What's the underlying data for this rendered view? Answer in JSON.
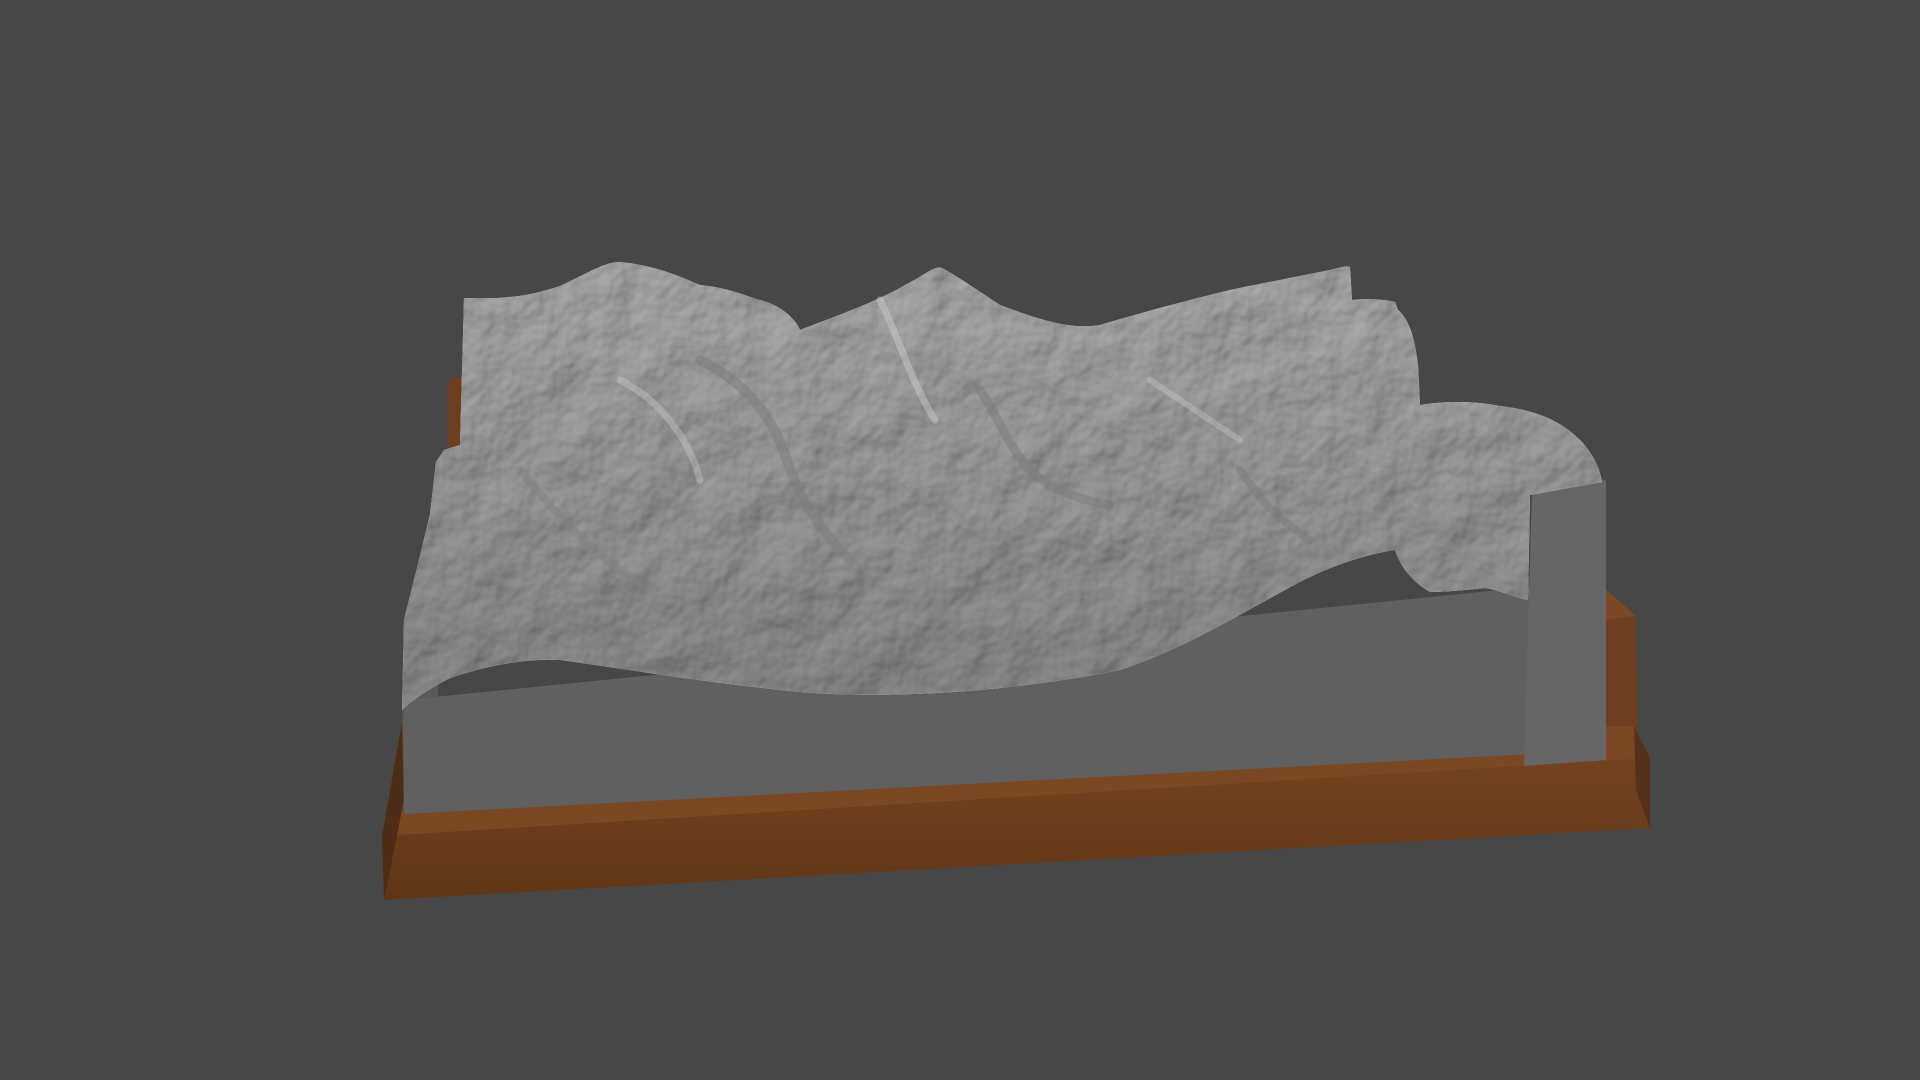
{
  "viewport": {
    "background_color": "#474747",
    "object": {
      "terrain_color": "#a3a3a3",
      "terrain_side_color": "#636363",
      "base_color": "#6b3f20",
      "base_dark_color": "#4e2d16"
    }
  }
}
